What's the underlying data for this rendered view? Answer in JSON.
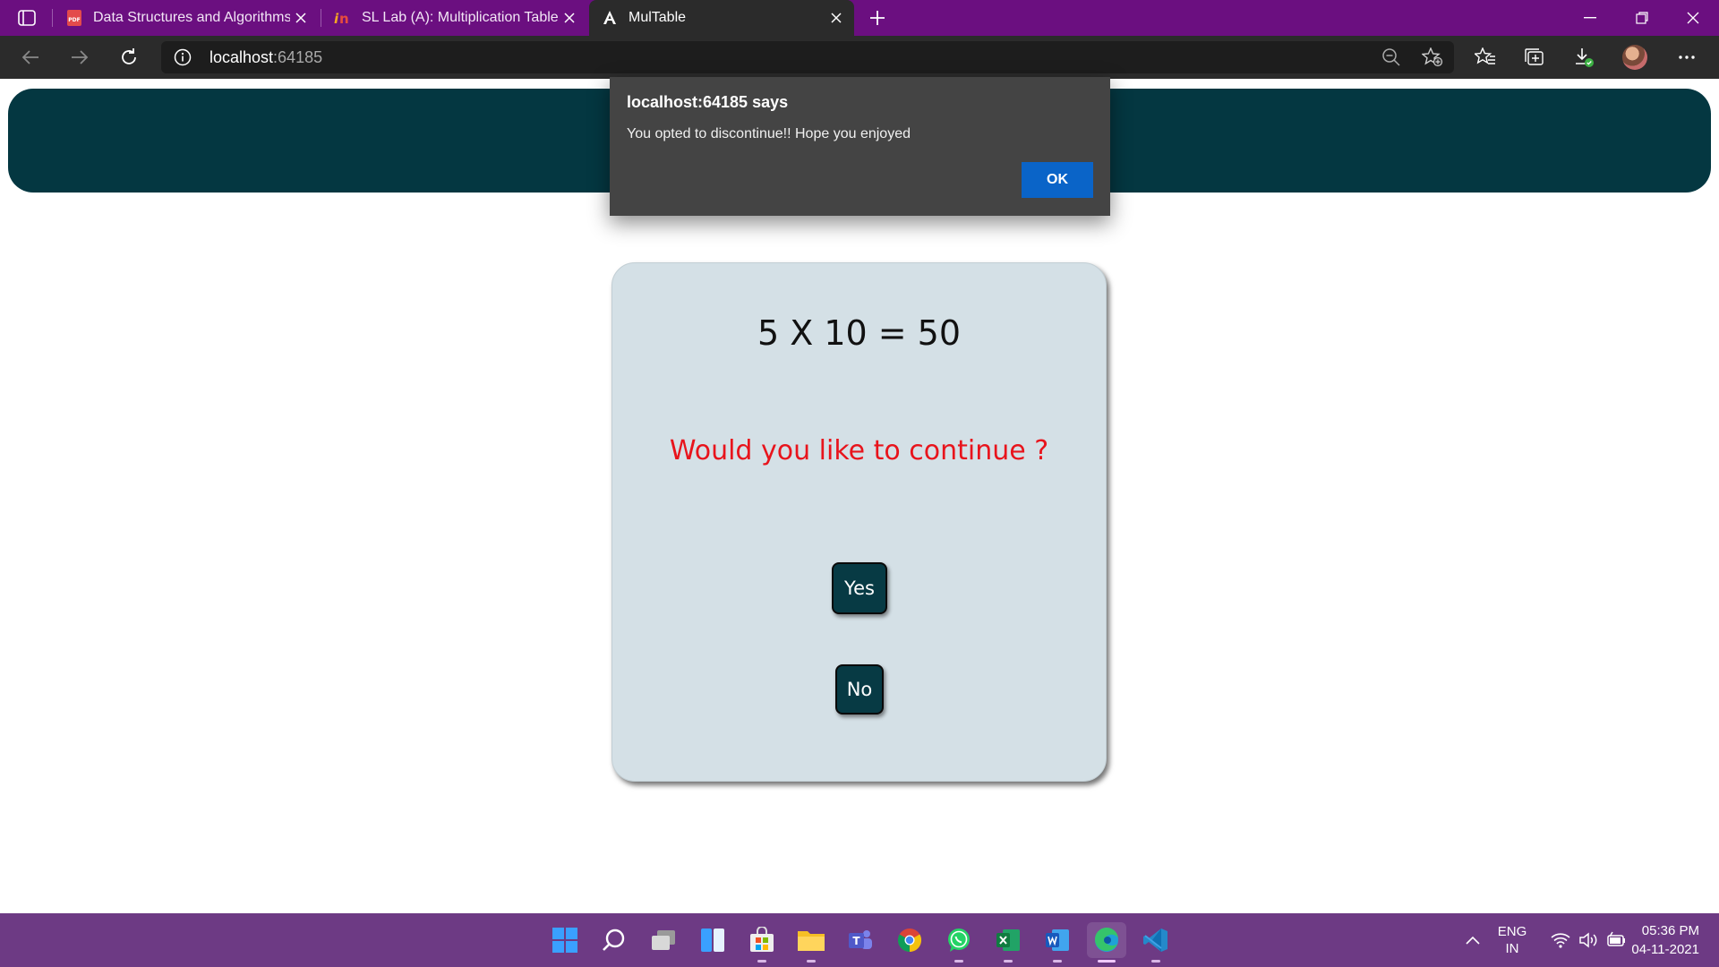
{
  "browser": {
    "tabs": [
      {
        "title": "Data Structures and Algorithms",
        "favicon": "pdf-icon",
        "active": false
      },
      {
        "title": "SL Lab (A): Multiplication Table u",
        "favicon": "infosys-springboard-icon",
        "active": false
      },
      {
        "title": "MulTable",
        "favicon": "angular-icon",
        "active": true
      }
    ],
    "url_host": "localhost",
    "url_port": ":64185"
  },
  "page": {
    "equation": "5 X 10 = 50",
    "question": "Would you like to continue ?",
    "yes_label": "Yes",
    "no_label": "No"
  },
  "dialog": {
    "title": "localhost:64185 says",
    "message": "You opted to discontinue!! Hope you enjoyed",
    "ok_label": "OK"
  },
  "taskbar": {
    "apps": [
      "start",
      "search",
      "task-view",
      "widgets",
      "microsoft-store",
      "file-explorer",
      "teams",
      "chrome",
      "whatsapp",
      "excel",
      "word",
      "edge",
      "vscode"
    ],
    "language_line1": "ENG",
    "language_line2": "IN",
    "time": "05:36 PM",
    "date": "04-11-2021"
  },
  "colors": {
    "tabbar": "#6b0f80",
    "header_banner": "#043741",
    "card_bg": "#d4e0e6",
    "question_text": "#e8141c",
    "button_bg": "#073a44",
    "dialog_bg": "#444444",
    "dialog_ok": "#0a64c8",
    "taskbar": "#6d3a84"
  }
}
